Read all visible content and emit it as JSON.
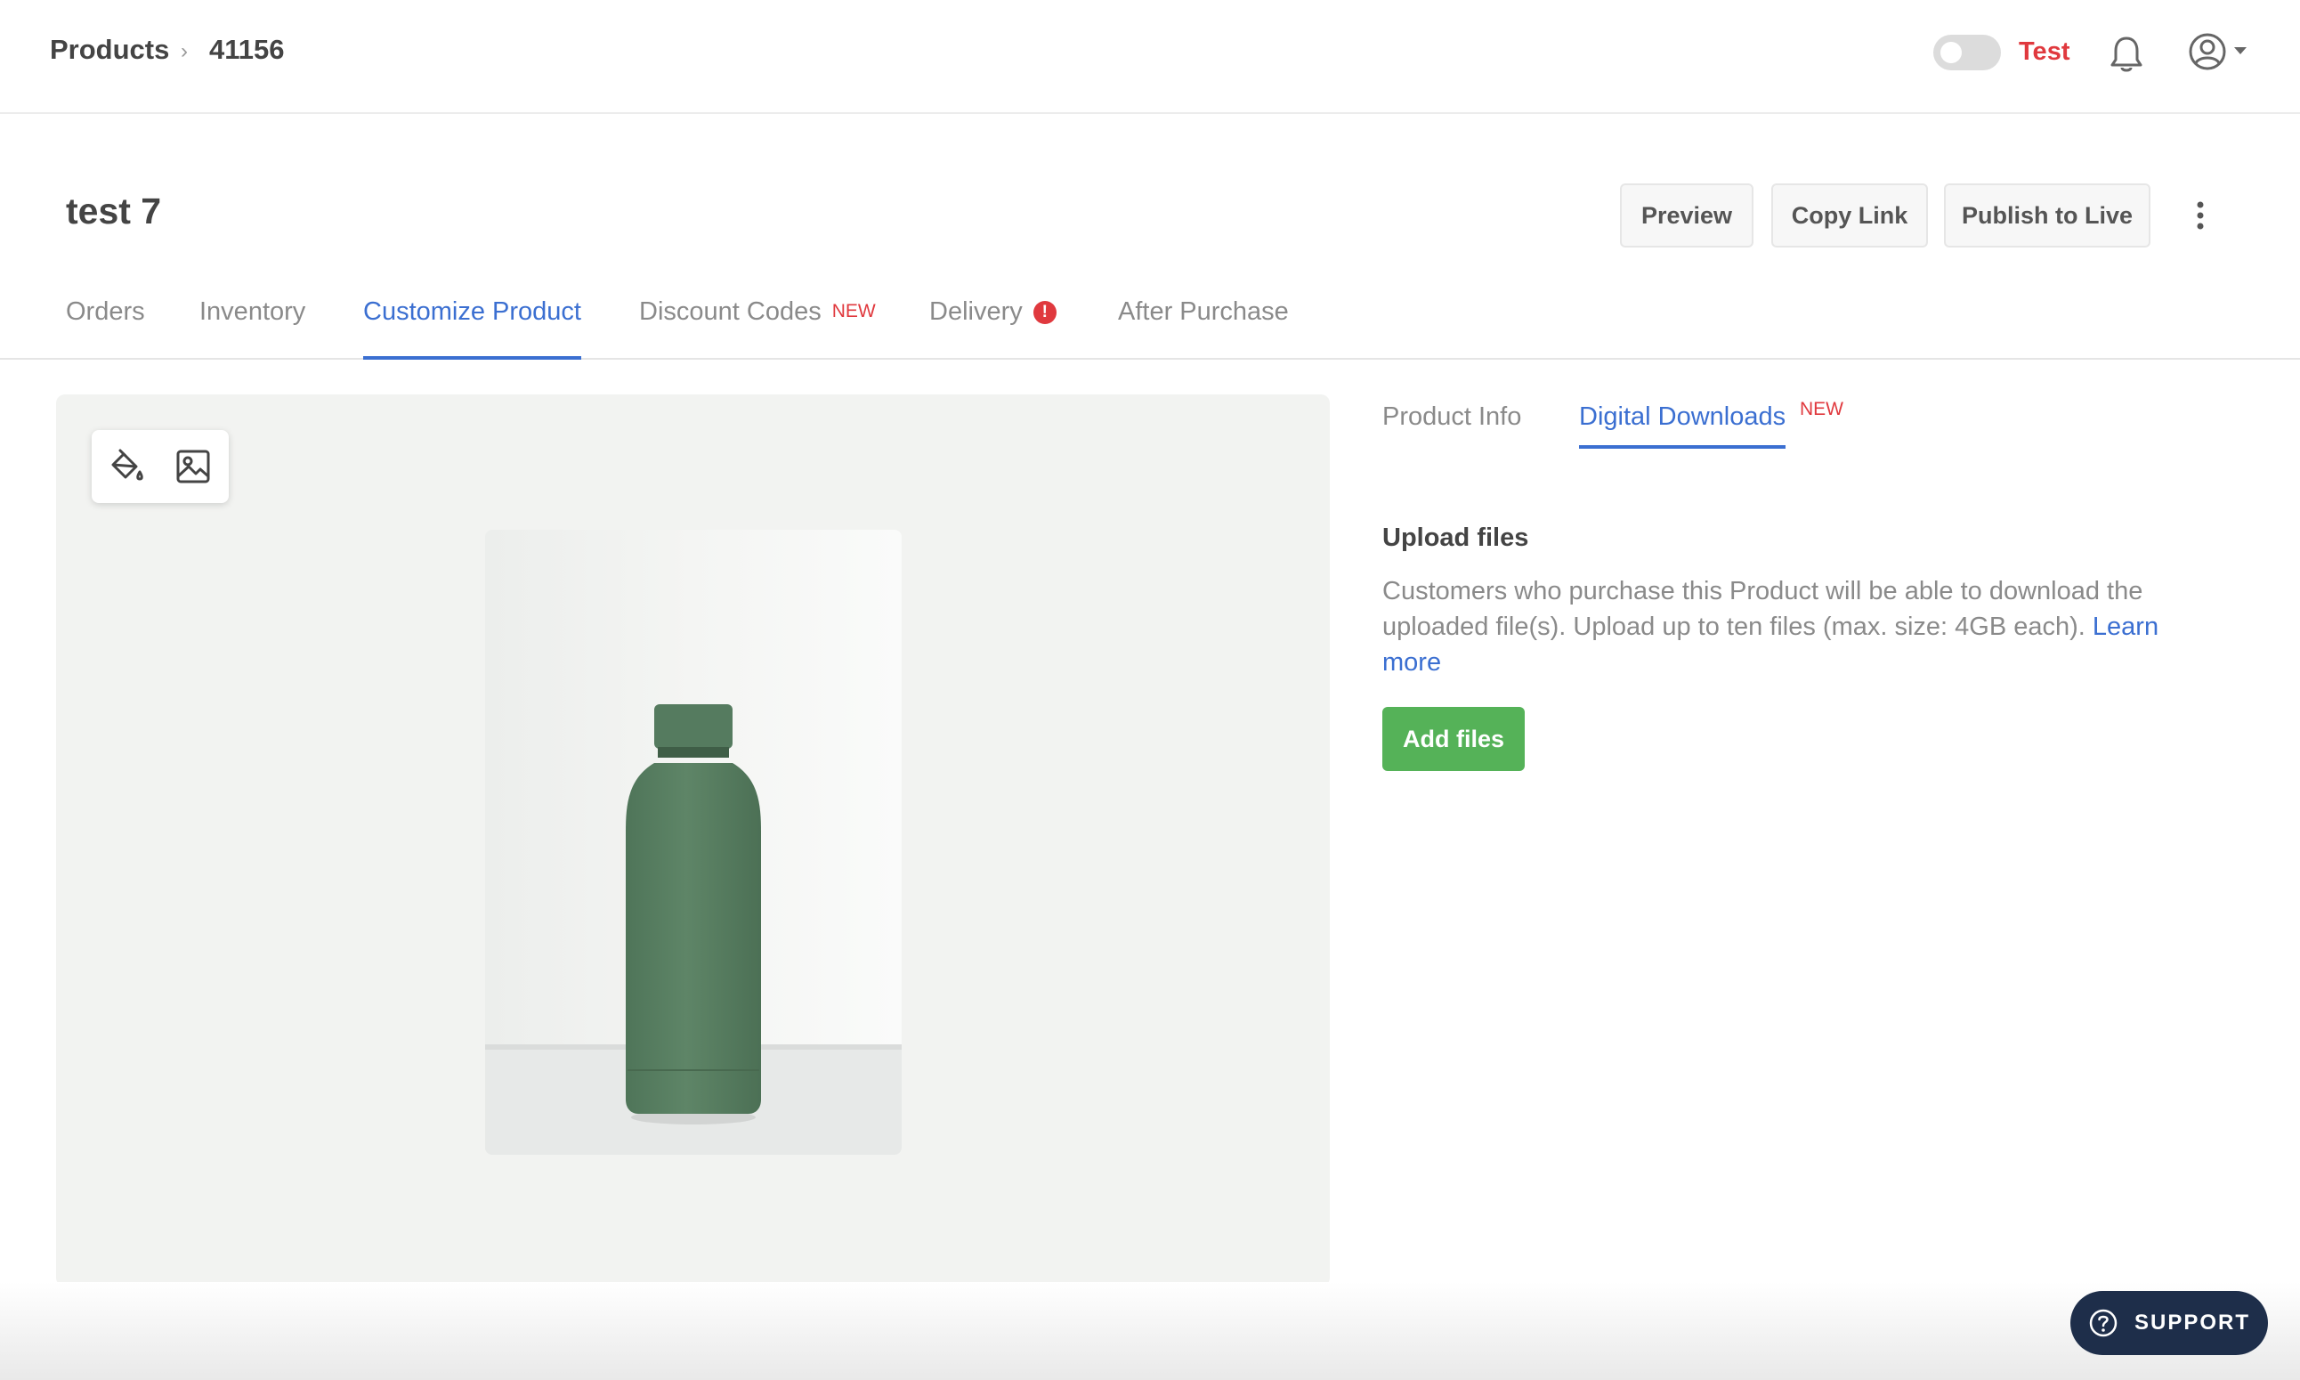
{
  "breadcrumb": {
    "products": "Products",
    "separator": "›",
    "id": "41156"
  },
  "topbar": {
    "mode_label": "Test",
    "mode_toggle_on": false
  },
  "header": {
    "title": "test 7",
    "preview_label": "Preview",
    "copy_link_label": "Copy Link",
    "publish_label": "Publish to Live"
  },
  "tabs": [
    {
      "label": "Orders"
    },
    {
      "label": "Inventory"
    },
    {
      "label": "Customize Product",
      "active": true
    },
    {
      "label": "Discount Codes",
      "badge": "NEW"
    },
    {
      "label": "Delivery",
      "alert": "!"
    },
    {
      "label": "After Purchase"
    }
  ],
  "subtabs": [
    {
      "label": "Product Info"
    },
    {
      "label": "Digital Downloads",
      "badge": "NEW",
      "active": true
    }
  ],
  "upload": {
    "title": "Upload files",
    "description": "Customers who purchase this Product will be able to download the uploaded file(s). Upload up to ten files (max. size: 4GB each).",
    "learn_more": "Learn more",
    "add_files_label": "Add files"
  },
  "support": {
    "label": "SUPPORT"
  },
  "colors": {
    "accent": "#3b6fd1",
    "alert_red": "#e0393e",
    "success_green": "#55b258",
    "support_navy": "#1e2e4a",
    "bottle_green": "#5a8163"
  },
  "icons": [
    "bell-icon",
    "user-icon",
    "paint-bucket-icon",
    "image-icon",
    "kebab-icon",
    "help-icon"
  ]
}
